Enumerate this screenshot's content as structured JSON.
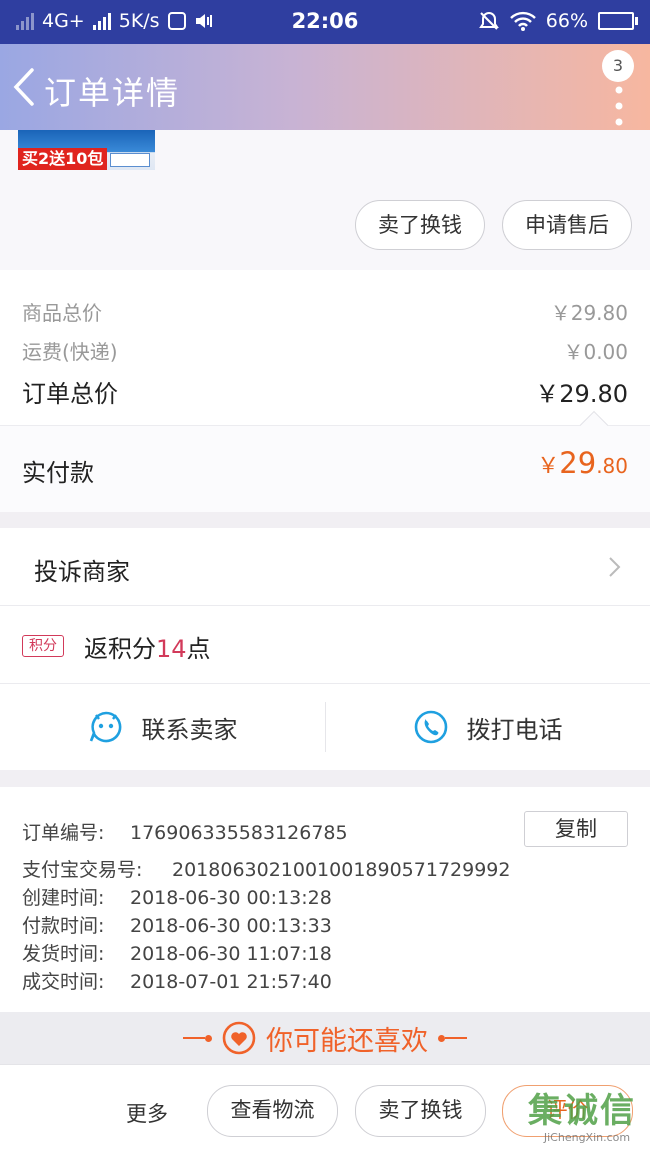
{
  "status_bar": {
    "network": "4G+",
    "speed": "5K/s",
    "time": "22:06",
    "battery": "66%",
    "battery_level": 0.66
  },
  "header": {
    "title": "订单详情",
    "badge": "3"
  },
  "product": {
    "promo_text": "买2送10包",
    "actions": [
      "卖了换钱",
      "申请售后"
    ]
  },
  "pricing": {
    "goods_total_label": "商品总价",
    "goods_total": "￥29.80",
    "shipping_label": "运费(快递)",
    "shipping": "￥0.00",
    "order_total_label": "订单总价",
    "order_total": "￥29.80",
    "paid_label": "实付款",
    "paid_currency": "￥",
    "paid_int": "29",
    "paid_dec": ".80"
  },
  "links": {
    "complain": "投诉商家",
    "points_tag": "积分",
    "points_prefix": "返积分",
    "points_value": "14",
    "points_suffix": "点",
    "contact_seller": "联系卖家",
    "call_phone": "拨打电话"
  },
  "order_info": {
    "order_no_label": "订单编号:",
    "order_no": "176906335583126785",
    "copy_label": "复制",
    "alipay_label": "支付宝交易号:",
    "alipay_no": "2018063021001001890571729992",
    "created_label": "创建时间:",
    "created": "2018-06-30 00:13:28",
    "paid_time_label": "付款时间:",
    "paid_time": "2018-06-30 00:13:33",
    "shipped_label": "发货时间:",
    "shipped": "2018-06-30 11:07:18",
    "closed_label": "成交时间:",
    "closed": "2018-07-01 21:57:40"
  },
  "recommend": {
    "title": "你可能还喜欢"
  },
  "bottom_bar": {
    "more": "更多",
    "logistics": "查看物流",
    "sell": "卖了换钱",
    "evaluate": "评价"
  },
  "watermark": {
    "text": "集诚信",
    "url": "JiChengXin.com"
  },
  "colors": {
    "status_bar": "#2f3ea0",
    "accent_orange": "#e8641e",
    "points_red": "#d23a5a",
    "icon_blue": "#1fa0e0"
  }
}
